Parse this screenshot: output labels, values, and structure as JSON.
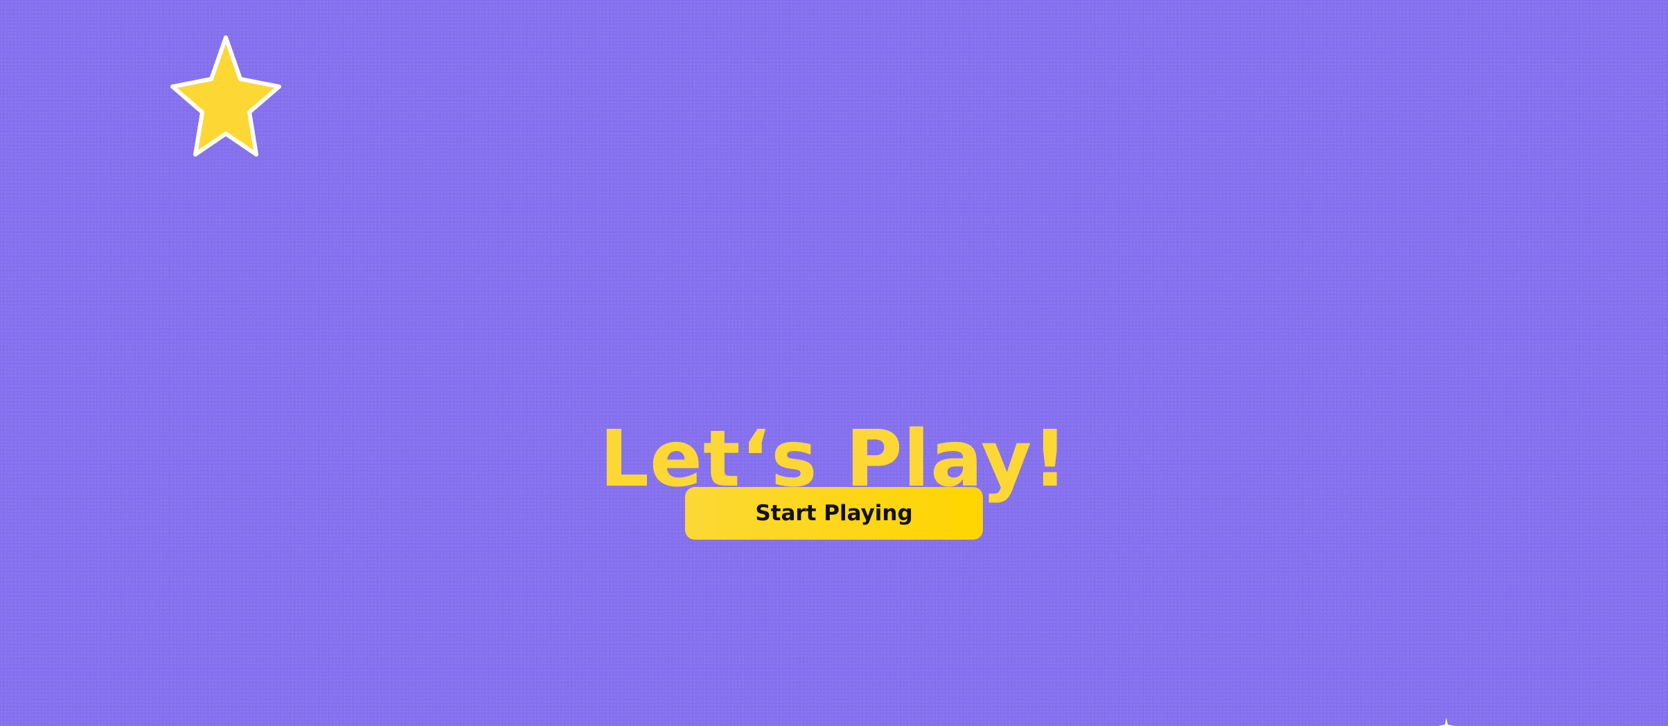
{
  "screen": {
    "title": "Let‘s Play!",
    "start_button_label": "Start Playing"
  },
  "decorations": {
    "top_left": "star-icon",
    "bottom_right": "sparkle-icon"
  },
  "colors": {
    "background": "#8571ee",
    "title": "#fdd835",
    "button": "#ffd500",
    "button_text": "#111111",
    "star_fill": "#fdd835",
    "star_outline": "#ffffff"
  }
}
